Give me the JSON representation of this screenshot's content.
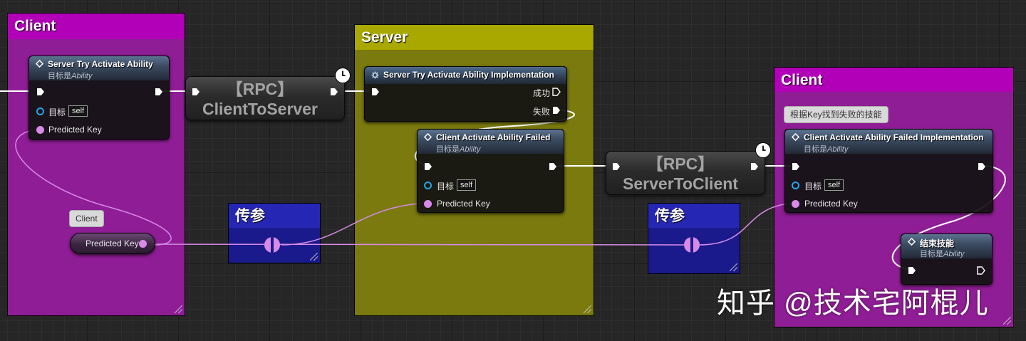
{
  "comments": {
    "client_left": {
      "title": "Client",
      "color": "#9a1d9f",
      "header": "#b200b8"
    },
    "server": {
      "title": "Server",
      "color": "#7c7c10",
      "header": "#a6a600"
    },
    "client_right": {
      "title": "Client",
      "color": "#9a1d9f",
      "header": "#b200b8"
    },
    "param_left": {
      "title": "传参",
      "color": "#1d1d8f",
      "header": "#2828b8"
    },
    "param_right": {
      "title": "传参",
      "color": "#1d1d8f",
      "header": "#2828b8"
    }
  },
  "nodes": {
    "server_try_activate": {
      "title": "Server Try Activate Ability",
      "sub_prefix": "目标是",
      "sub_italic": "Ability",
      "target_label": "目标",
      "self_label": "self",
      "key_label": "Predicted Key"
    },
    "server_try_impl": {
      "title": "Server Try Activate Ability Implementation",
      "success_label": "成功",
      "fail_label": "失败"
    },
    "client_failed": {
      "title": "Client Activate Ability Failed",
      "sub_prefix": "目标是",
      "sub_italic": "Ability",
      "target_label": "目标",
      "self_label": "self",
      "key_label": "Predicted Key"
    },
    "client_failed_impl": {
      "title": "Client Activate Ability Failed Implementation",
      "sub_prefix": "目标是",
      "sub_italic": "Ability",
      "target_label": "目标",
      "self_label": "self",
      "key_label": "Predicted Key",
      "comment_bubble": "根据Key找到失败的技能"
    },
    "end_ability": {
      "title": "结束技能",
      "sub_prefix": "目标是",
      "sub_italic": "Ability"
    },
    "predicted_key_var": {
      "label": "Predicted Key",
      "bubble": "Client"
    }
  },
  "rpc": {
    "client_to_server": {
      "line1": "【RPC】",
      "line2": "ClientToServer"
    },
    "server_to_client": {
      "line1": "【RPC】",
      "line2": "ServerToClient"
    }
  },
  "colors": {
    "exec_wire": "#ffffff",
    "data_wire": "#d78ae8",
    "target_pin": "#24a4e8"
  },
  "watermark": "知乎 @技术宅阿棍儿"
}
